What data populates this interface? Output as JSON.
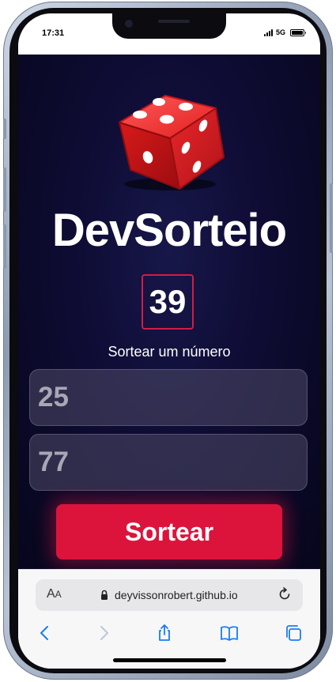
{
  "status_bar": {
    "time": "17:31",
    "network": "5G"
  },
  "app": {
    "title": "DevSorteio",
    "result": "39",
    "subtitle": "Sortear um número",
    "min_value": "25",
    "max_value": "77",
    "button_label": "Sortear"
  },
  "browser": {
    "aa_label_big": "A",
    "aa_label_small": "A",
    "url": "deyvissonrobert.github.io"
  },
  "colors": {
    "accent": "#dc143c",
    "background": "#0e0c33"
  },
  "icons": [
    "dice-icon",
    "lock-icon",
    "reload-icon",
    "back-icon",
    "forward-icon",
    "share-icon",
    "bookmarks-icon",
    "tabs-icon"
  ]
}
